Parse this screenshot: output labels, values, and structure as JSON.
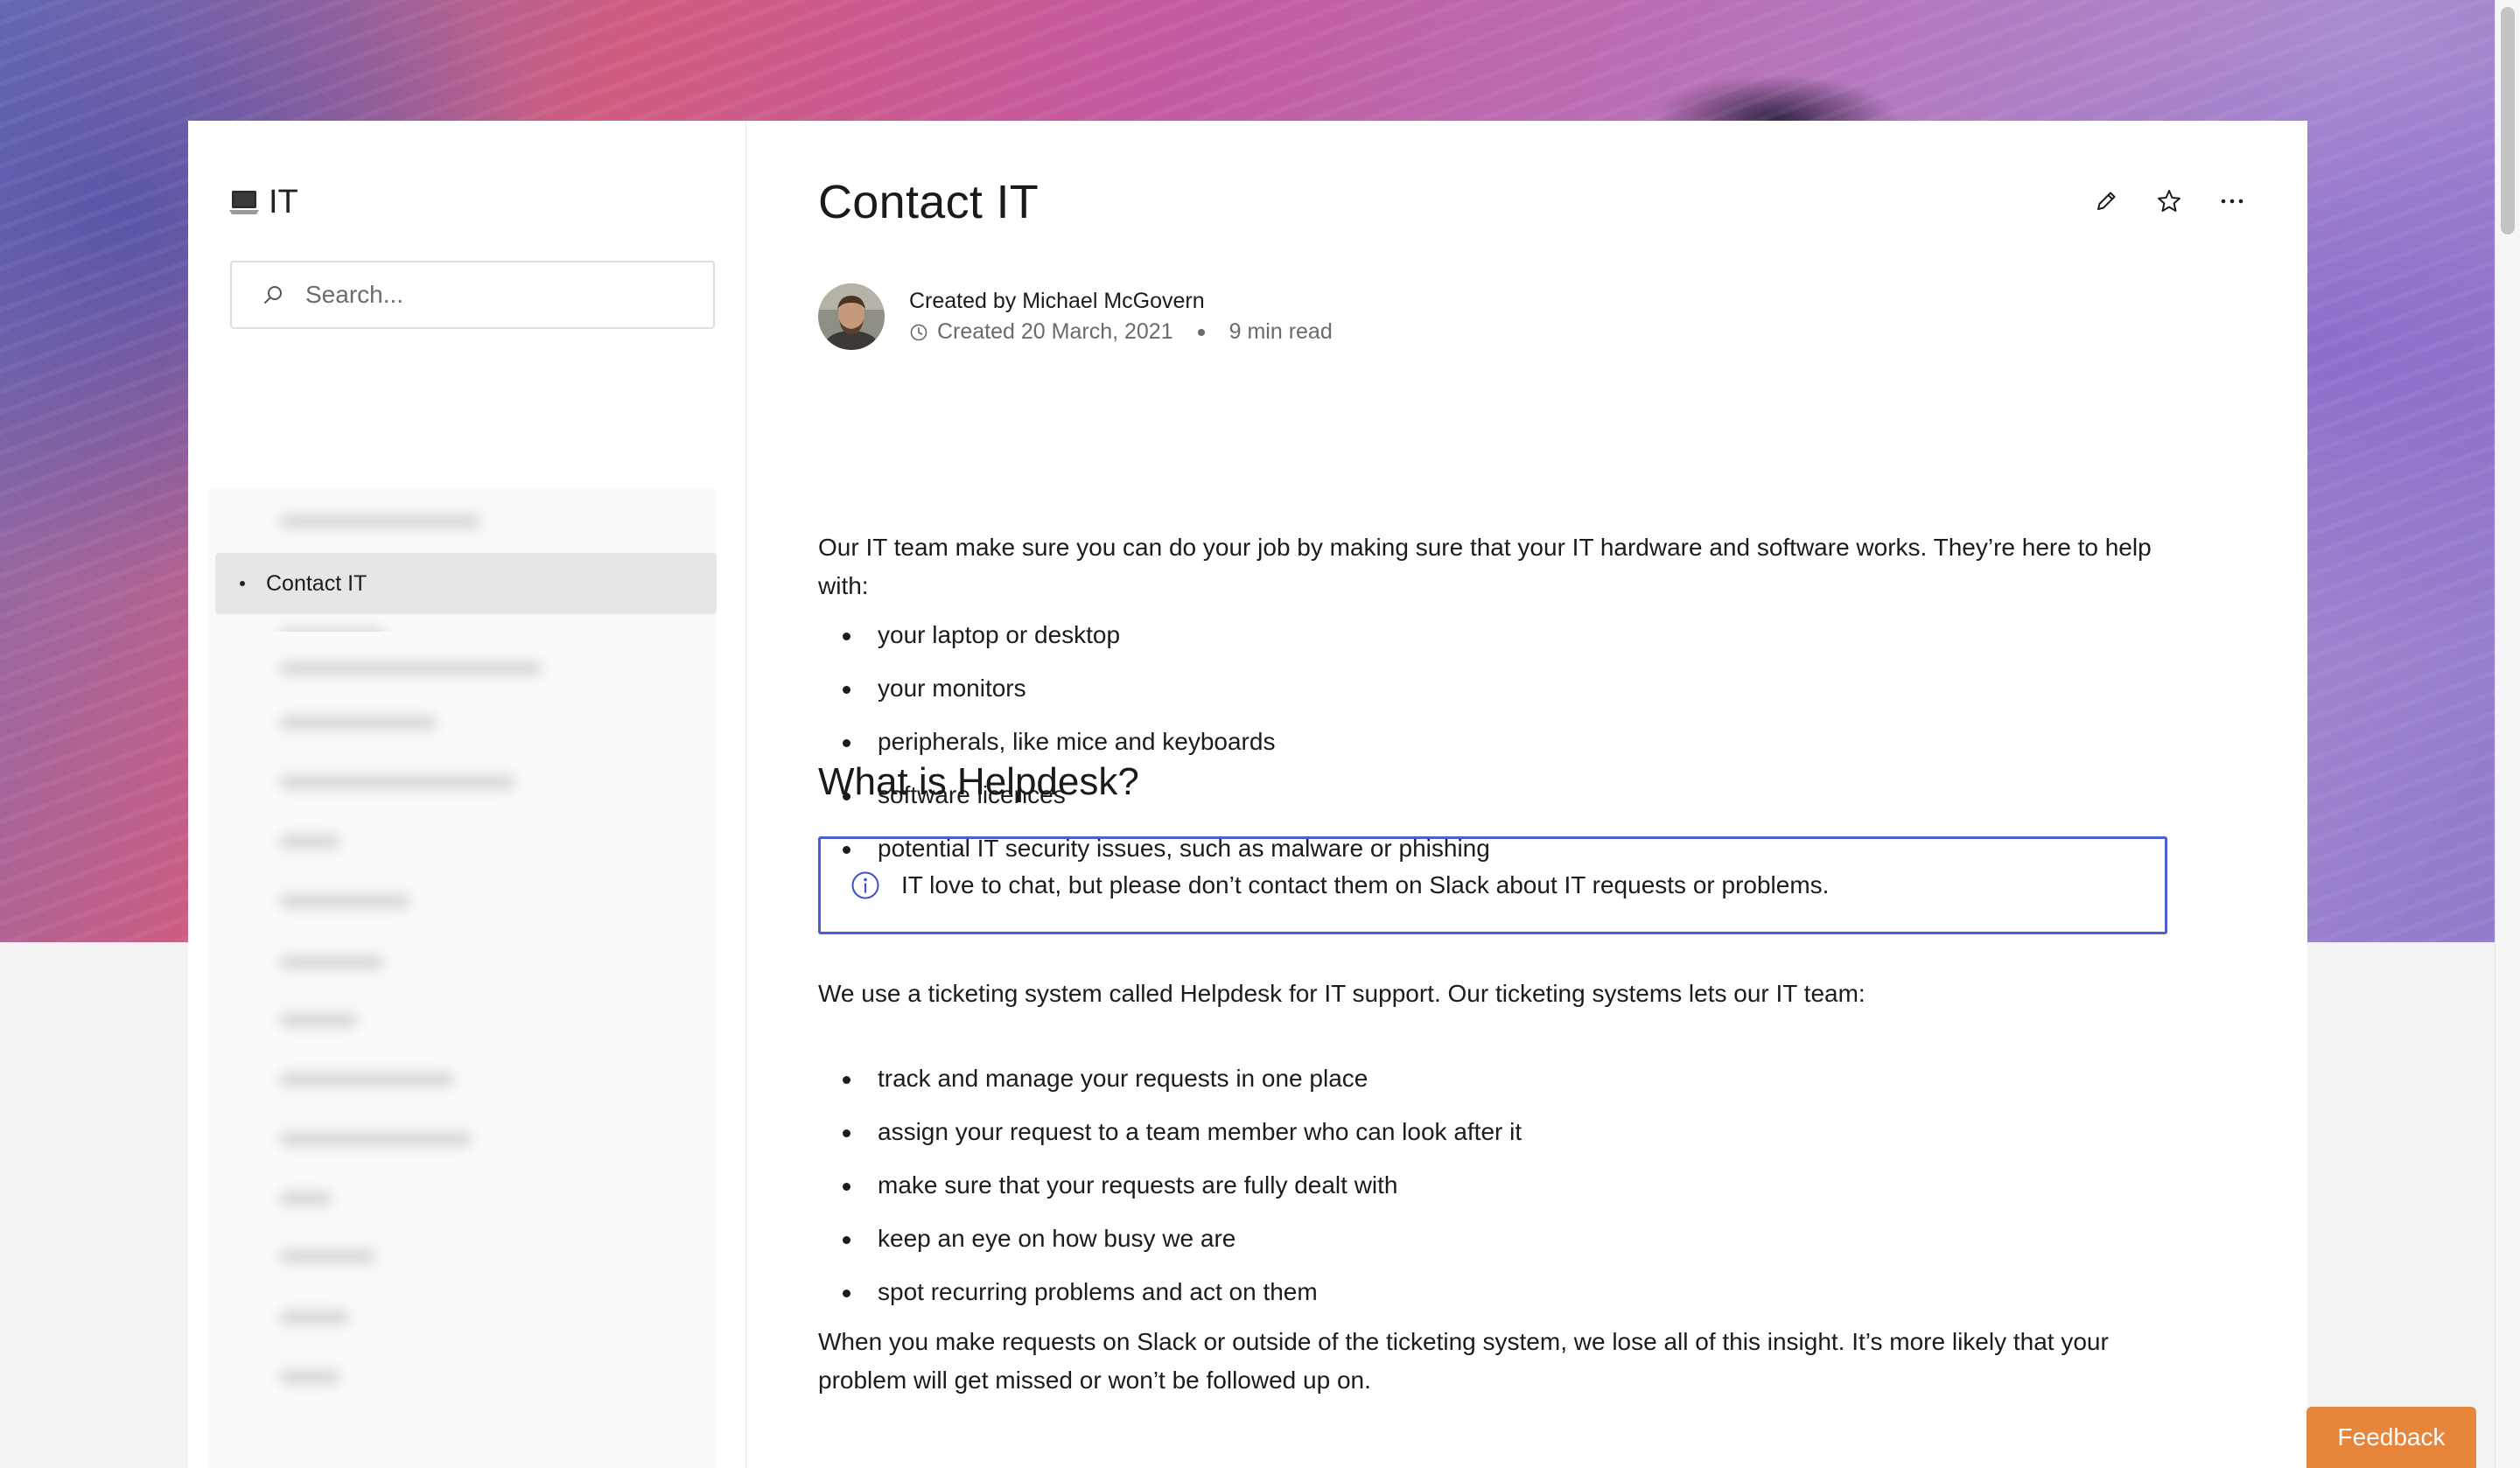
{
  "sidebar": {
    "space_name": "IT",
    "search_placeholder": "Search...",
    "active_item": "Contact IT"
  },
  "page": {
    "title": "Contact IT",
    "created_by": "Created by Michael McGovern",
    "created_date": "Created 20 March, 2021",
    "read_time": "9 min read",
    "intro": "Our IT team make sure you can do your job by making sure that your IT hardware and software works. They’re here to help with:",
    "help_list": [
      "your laptop or desktop",
      "your monitors",
      "peripherals, like mice and keyboards",
      "software licences",
      "potential IT security issues, such as malware or phishing"
    ],
    "heading": "What is Helpdesk?",
    "info": "IT love to chat, but please don’t contact them on Slack about IT requests or problems.",
    "helpdesk_intro": "We use a ticketing system called Helpdesk for IT support. Our ticketing systems lets our IT team:",
    "helpdesk_list": [
      "track and manage your requests in one place",
      "assign your request to a team member who can look after it",
      "make sure that your requests are fully dealt with",
      "keep an eye on how busy we are",
      "spot recurring problems and act on them"
    ],
    "closing": "When you make requests on Slack or outside of the ticketing system, we lose all of this insight. It’s more likely that your problem will get missed or won’t be followed up on."
  },
  "feedback_label": "Feedback",
  "colors": {
    "accent_border": "#4a5ed6",
    "feedback": "#e8853d",
    "active_nav": "#e6e6e6"
  },
  "icons": [
    "laptop-icon",
    "search-icon",
    "edit-pencil-icon",
    "star-icon",
    "more-icon",
    "clock-icon",
    "info-icon"
  ]
}
